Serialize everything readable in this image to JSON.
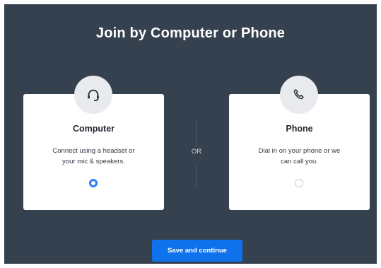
{
  "dialog": {
    "title": "Join by Computer or Phone",
    "divider_label": "OR",
    "save_button": "Save and continue"
  },
  "options": [
    {
      "name": "Computer",
      "description_line1": "Connect using a headset or",
      "description_line2": "your mic & speakers.",
      "icon": "headset-icon",
      "selected": true
    },
    {
      "name": "Phone",
      "description_line1": "Dial in on your phone or we",
      "description_line2": "can call you.",
      "icon": "phone-icon",
      "selected": false
    }
  ],
  "colors": {
    "background": "#364150",
    "accent": "#0e72ed",
    "radio_selected": "#2d7ff9"
  }
}
